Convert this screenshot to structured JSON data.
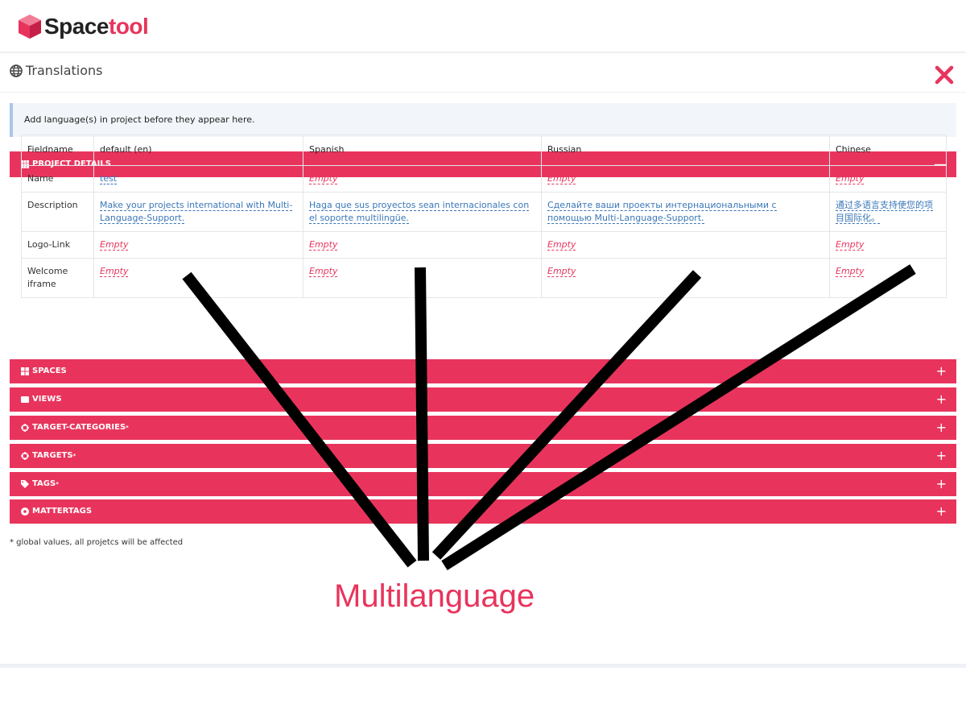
{
  "brand": {
    "name_part1": "Space",
    "name_part2": "tool",
    "accent_color": "#e8345c"
  },
  "panel": {
    "title": "Translations",
    "title_icon": "globe-icon",
    "close_icon": "close-icon"
  },
  "notice": "Add language(s) in project before they appear here.",
  "sections": {
    "project_details": {
      "label": "PROJECT DETAILS",
      "toggle": "—"
    },
    "spaces": {
      "label": "SPACES",
      "toggle": "+"
    },
    "views": {
      "label": "VIEWS",
      "toggle": "+"
    },
    "target_categories": {
      "label": "TARGET-CATEGORIES",
      "toggle": "+"
    },
    "targets": {
      "label": "TARGETS",
      "toggle": "+"
    },
    "tags": {
      "label": "TAGS",
      "toggle": "+"
    },
    "mattertags": {
      "label": "MATTERTAGS",
      "toggle": "+"
    }
  },
  "table": {
    "headers": [
      "Fieldname",
      "default (en)",
      "Spanish",
      "Russian",
      "Chinese"
    ],
    "rows": [
      {
        "field": "Name",
        "values": [
          "test",
          "Empty",
          "Empty",
          "Empty"
        ]
      },
      {
        "field": "Description",
        "values": [
          "Make your projects international with Multi-Language-Support.",
          "Haga que sus proyectos sean internacionales con el soporte multilingüe.",
          "Сделайте ваши проекты интернациональными с помощью Multi-Language-Support.",
          "通过多语言支持使您的项目国际化。"
        ]
      },
      {
        "field": "Logo-Link",
        "values": [
          "Empty",
          "Empty",
          "Empty",
          "Empty"
        ]
      },
      {
        "field": "Welcome iframe",
        "values": [
          "Empty",
          "Empty",
          "Empty",
          "Empty"
        ]
      }
    ]
  },
  "asterisk": "*",
  "footnote": "* global values, all projetcs will be affected",
  "caption": "Multilanguage"
}
